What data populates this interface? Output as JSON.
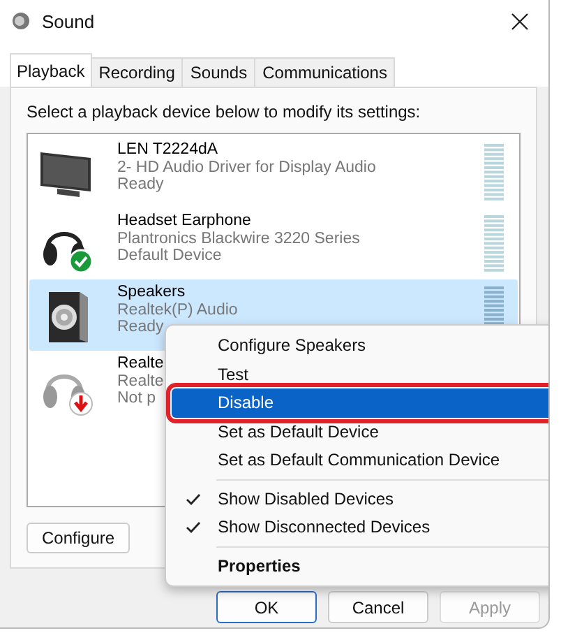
{
  "window": {
    "title": "Sound"
  },
  "tabs": [
    {
      "label": "Playback",
      "selected": true
    },
    {
      "label": "Recording",
      "selected": false
    },
    {
      "label": "Sounds",
      "selected": false
    },
    {
      "label": "Communications",
      "selected": false
    }
  ],
  "instruction": "Select a playback device below to modify its settings:",
  "devices": [
    {
      "name": "LEN T2224dA",
      "driver": "2- HD Audio Driver for Display Audio",
      "status": "Ready",
      "kind": "monitor",
      "default_device": false,
      "disconnected": false,
      "selected": false
    },
    {
      "name": "Headset Earphone",
      "driver": "Plantronics Blackwire 3220 Series",
      "status": "Default Device",
      "kind": "headset",
      "default_device": true,
      "disconnected": false,
      "selected": false
    },
    {
      "name": "Speakers",
      "driver": "Realtek(P) Audio",
      "status": "Ready",
      "kind": "speaker",
      "default_device": false,
      "disconnected": false,
      "selected": true
    },
    {
      "name": "Realte",
      "driver": "Realte",
      "status": "Not p",
      "kind": "headset",
      "default_device": false,
      "disconnected": true,
      "selected": false
    }
  ],
  "configure_button": "Configure",
  "buttons": [
    {
      "label": "OK",
      "disabled": false
    },
    {
      "label": "Cancel",
      "disabled": false
    },
    {
      "label": "Apply",
      "disabled": true
    }
  ],
  "context_menu": [
    {
      "kind": "item",
      "label": "Configure Speakers",
      "selected": false,
      "checked": false,
      "bold": false,
      "outlined": false
    },
    {
      "kind": "item",
      "label": "Test",
      "selected": false,
      "checked": false,
      "bold": false,
      "outlined": false
    },
    {
      "kind": "item",
      "label": "Disable",
      "selected": true,
      "checked": false,
      "bold": false,
      "outlined": true
    },
    {
      "kind": "item",
      "label": "Set as Default Device",
      "selected": false,
      "checked": false,
      "bold": false,
      "outlined": false
    },
    {
      "kind": "item",
      "label": "Set as Default Communication Device",
      "selected": false,
      "checked": false,
      "bold": false,
      "outlined": false
    },
    {
      "kind": "separator"
    },
    {
      "kind": "item",
      "label": "Show Disabled Devices",
      "selected": false,
      "checked": true,
      "bold": false,
      "outlined": false
    },
    {
      "kind": "item",
      "label": "Show Disconnected Devices",
      "selected": false,
      "checked": true,
      "bold": false,
      "outlined": false
    },
    {
      "kind": "separator"
    },
    {
      "kind": "item",
      "label": "Properties",
      "selected": false,
      "checked": false,
      "bold": true,
      "outlined": false
    }
  ]
}
